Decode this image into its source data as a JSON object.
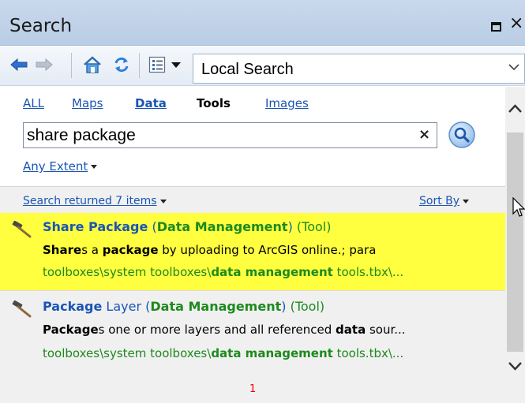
{
  "window": {
    "title": "Search"
  },
  "toolbar": {
    "scope_value": "Local Search"
  },
  "tabs": [
    {
      "label": "ALL"
    },
    {
      "label": "Maps"
    },
    {
      "label": "Data"
    },
    {
      "label": "Tools"
    },
    {
      "label": "Images"
    }
  ],
  "search": {
    "query": "share package",
    "clear_label": "×"
  },
  "extent": {
    "label": "Any Extent"
  },
  "results_bar": {
    "count_text": "Search returned 7 items",
    "sort_label": "Sort By"
  },
  "results": [
    {
      "name": "Share Package",
      "toolbox": "Data Management",
      "type": "(Tool)",
      "summary_bold1": "Share",
      "summary_t1": "s a ",
      "summary_bold2": "package",
      "summary_t2": " by uploading to ArcGIS online.; para",
      "path_t1": "toolboxes\\system toolboxes\\",
      "path_bold": "data management",
      "path_t2": " tools.tbx\\..."
    },
    {
      "name": "Package",
      "name_rest": " Layer",
      "toolbox": "Data Management",
      "type": "(Tool)",
      "summary_bold1": "Package",
      "summary_t1": "s one or more layers and all referenced ",
      "summary_bold2": "data",
      "summary_t2": " sour...",
      "path_t1": "toolboxes\\system toolboxes\\",
      "path_bold": "data management",
      "path_t2": " tools.tbx\\..."
    }
  ],
  "pager": {
    "page": "1"
  },
  "colors": {
    "highlight": "#ffff40",
    "link": "#1a55b3",
    "match_green": "#1c8a1c",
    "page_number": "#ee0000"
  }
}
